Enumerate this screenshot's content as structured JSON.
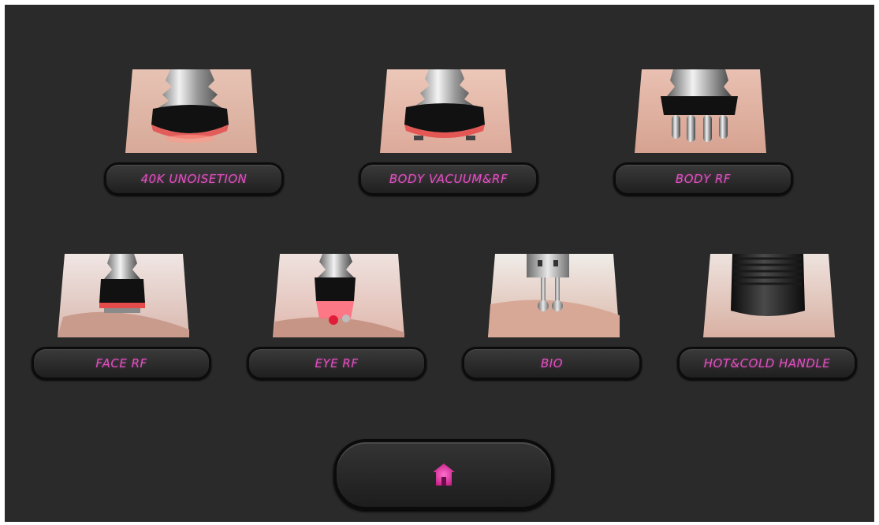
{
  "menu": {
    "items": [
      {
        "label": "40K UNOISETION",
        "icon": "cavitation-handle-icon"
      },
      {
        "label": "BODY VACUUM&RF",
        "icon": "vacuum-rf-handle-icon"
      },
      {
        "label": "BODY RF",
        "icon": "body-rf-handle-icon"
      },
      {
        "label": "FACE RF",
        "icon": "face-rf-handle-icon"
      },
      {
        "label": "EYE RF",
        "icon": "eye-rf-handle-icon"
      },
      {
        "label": "BIO",
        "icon": "bio-handle-icon"
      },
      {
        "label": "HOT&COLD HANDLE",
        "icon": "hot-cold-handle-icon"
      }
    ]
  },
  "home": {
    "icon": "home-icon"
  },
  "colors": {
    "background": "#2a2a2a",
    "accent_text": "#e24fc2",
    "home_icon": "#e83aa8"
  }
}
